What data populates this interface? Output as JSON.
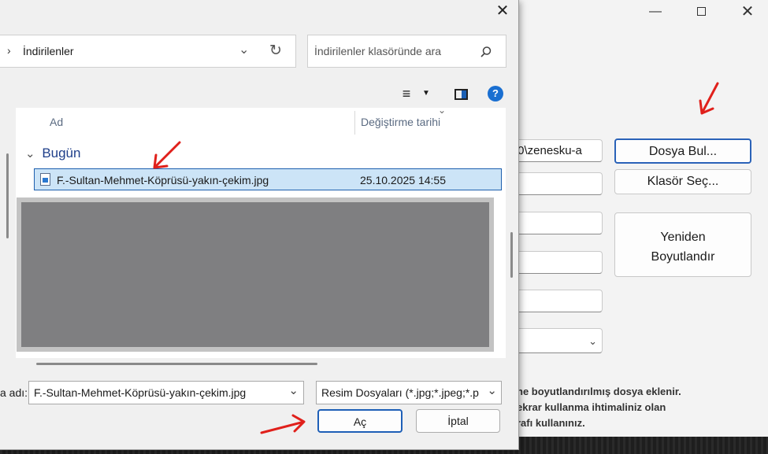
{
  "dialog": {
    "address": {
      "breadcrumb": "İndirilenler"
    },
    "search": {
      "placeholder": "İndirilenler klasöründe ara"
    },
    "columns": {
      "name": "Ad",
      "modified": "Değiştirme tarihi"
    },
    "groups": [
      {
        "label": "Bugün",
        "files": [
          {
            "name": "F.-Sultan-Mehmet-Köprüsü-yakın-çekim.jpg",
            "modified": "25.10.2025 14:55"
          }
        ]
      }
    ],
    "filename_label": "a adı:",
    "filename_value": "F.-Sultan-Mehmet-Köprüsü-yakın-çekim.jpg",
    "filetype_value": "Resim Dosyaları (*.jpg;*.jpeg;*.p",
    "open_label": "Aç",
    "cancel_label": "İptal"
  },
  "app": {
    "path_value": ".0\\zenesku-a",
    "find_file_label": "Dosya Bul...",
    "select_folder_label": "Klasör Seç...",
    "resize_line1": "Yeniden",
    "resize_line2": "Boyutlandır",
    "notes": [
      "ne boyutlandırılmış dosya eklenir.",
      "ekrar kullanma ihtimaliniz olan",
      "rafı kullanınız."
    ]
  },
  "annotations": {
    "arrow_color": "#e0201b"
  },
  "icons": [
    "close-icon",
    "chevron-right-icon",
    "chevron-down-icon",
    "refresh-icon",
    "search-icon",
    "view-list-icon",
    "preview-pane-icon",
    "help-icon",
    "image-file-icon",
    "minimize-icon",
    "maximize-icon"
  ]
}
